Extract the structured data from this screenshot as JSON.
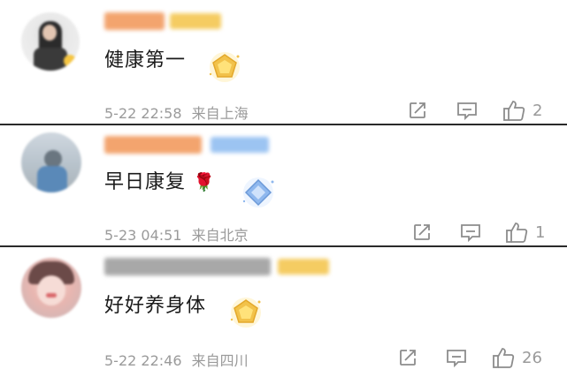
{
  "comments": [
    {
      "text": "健康第一",
      "timestamp": "5-22 22:58",
      "location": "来自上海",
      "likes": "2",
      "sticker": "gold-pentagon-badge",
      "name_blur_color": "#f3a46e",
      "badge_blur_color": "#f5cc62"
    },
    {
      "text": "早日康复",
      "emoji": "🌹",
      "timestamp": "5-23 04:51",
      "location": "来自北京",
      "likes": "1",
      "sticker": "blue-diamond-badge",
      "name_blur_color": "#f3a46e",
      "badge_blur_color": "#9cc4f2"
    },
    {
      "text": "好好养身体",
      "timestamp": "5-22 22:46",
      "location": "来自四川",
      "likes": "26",
      "sticker": "gold-pentagon-badge",
      "name_blur_color": "#9a9a9a",
      "badge_blur_color": "#f5cc62"
    }
  ],
  "icons": {
    "share": "share-icon",
    "comment": "comment-icon",
    "like": "thumbs-up-icon"
  },
  "colors": {
    "text": "#1a1a1a",
    "meta": "#9a9a9a",
    "divider": "#2a2a2a",
    "gold": "#f2c24a",
    "blue": "#8fb8ee"
  }
}
